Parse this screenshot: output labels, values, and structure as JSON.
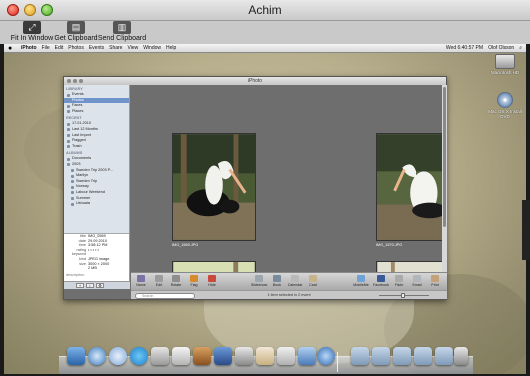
{
  "viewer": {
    "title": "Achim",
    "toolbar": [
      {
        "label": "Fit In Window",
        "icon": "fit-window-icon"
      },
      {
        "label": "Get Clipboard",
        "icon": "clipboard-in-icon"
      },
      {
        "label": "Send Clipboard",
        "icon": "clipboard-out-icon"
      }
    ]
  },
  "remote": {
    "menubar": {
      "app": "iPhoto",
      "items": [
        "File",
        "Edit",
        "Photos",
        "Events",
        "Share",
        "View",
        "Window",
        "Help"
      ],
      "clock": "Wed 6:40:57 PM",
      "user": "Olof Olsson"
    },
    "desktop_icons": [
      {
        "label": "Macintosh HD",
        "icon": "hard-drive-icon"
      },
      {
        "label": "Mac OS X Install DVD",
        "icon": "dvd-icon"
      }
    ],
    "iphoto": {
      "title": "iPhoto",
      "sidebar": {
        "library_header": "LIBRARY",
        "library": [
          "Events",
          "Photos",
          "Faces",
          "Places"
        ],
        "recent_header": "RECENT",
        "recent": [
          "17.01.2010",
          "Last 12 Months",
          "Last Import",
          "Flagged",
          "Trash"
        ],
        "albums_header": "ALBUMS",
        "albums": [
          "Documents",
          "2003",
          "Sweden Trip 2003 P...",
          "Marilyn",
          "Sweden Trip",
          "Norway",
          "Labour Weekend",
          "Summer",
          "Ushuaia"
        ]
      },
      "info": {
        "title_label": "title",
        "title_value": "IMG_0569",
        "date_label": "date",
        "date_value": "29.09.2010",
        "time_label": "time",
        "time_value": "3:58:12 PM",
        "rating_label": "rating",
        "rating_value": "• • • • •",
        "keyword_label": "keyword",
        "keyword_value": "",
        "kind_label": "kind",
        "kind_value": "JPEG image",
        "size_label": "size",
        "size_value": "3000 × 2000",
        "filesize_value": "2 MB",
        "description_placeholder": "description"
      },
      "photos": [
        {
          "caption": "IMG_1569.JPG"
        },
        {
          "caption": "IMG_1570.JPG"
        },
        {
          "caption": ""
        },
        {
          "caption": ""
        }
      ],
      "toolbar": [
        {
          "label": "Name",
          "icon": "info-icon"
        },
        {
          "label": "Edit",
          "icon": "edit-icon"
        },
        {
          "label": "Rotate",
          "icon": "rotate-icon"
        },
        {
          "label": "Flag",
          "icon": "flag-icon"
        },
        {
          "label": "Hide",
          "icon": "hide-icon"
        },
        {
          "label": "Slideshow",
          "icon": "slideshow-icon"
        },
        {
          "label": "Book",
          "icon": "book-icon"
        },
        {
          "label": "Calendar",
          "icon": "calendar-icon"
        },
        {
          "label": "Card",
          "icon": "card-icon"
        },
        {
          "label": "MobileMe",
          "icon": "mobileme-icon"
        },
        {
          "label": "Facebook",
          "icon": "facebook-icon"
        },
        {
          "label": "Flickr",
          "icon": "flickr-icon"
        },
        {
          "label": "Email",
          "icon": "email-icon"
        },
        {
          "label": "Print",
          "icon": "print-icon"
        }
      ],
      "status": "1 item selected in 2 event",
      "search_placeholder": "Search"
    }
  }
}
